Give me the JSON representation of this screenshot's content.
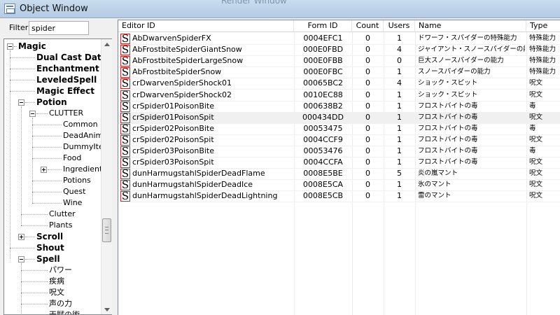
{
  "window": {
    "title": "Object Window",
    "background_title": "Render Window"
  },
  "filter": {
    "label": "Filter",
    "value": "spider"
  },
  "tree": {
    "items": [
      {
        "label": "Magic",
        "bold": true,
        "expander": "minus",
        "level": 0
      },
      {
        "label": "Dual Cast Data",
        "bold": true,
        "expander": "none",
        "level": 1
      },
      {
        "label": "Enchantment",
        "bold": true,
        "expander": "none",
        "level": 1
      },
      {
        "label": "LeveledSpell",
        "bold": true,
        "expander": "none",
        "level": 1
      },
      {
        "label": "Magic Effect",
        "bold": true,
        "expander": "none",
        "level": 1
      },
      {
        "label": "Potion",
        "bold": true,
        "expander": "minus",
        "level": 1
      },
      {
        "label": "CLUTTER",
        "bold": false,
        "expander": "minus",
        "level": 2
      },
      {
        "label": "Common",
        "bold": false,
        "expander": "none",
        "level": 3
      },
      {
        "label": "DeadAnima",
        "bold": false,
        "expander": "none",
        "level": 3
      },
      {
        "label": "DummyItem",
        "bold": false,
        "expander": "none",
        "level": 3
      },
      {
        "label": "Food",
        "bold": false,
        "expander": "none",
        "level": 3
      },
      {
        "label": "Ingredients",
        "bold": false,
        "expander": "plus",
        "level": 3
      },
      {
        "label": "Potions",
        "bold": false,
        "expander": "none",
        "level": 3
      },
      {
        "label": "Quest",
        "bold": false,
        "expander": "none",
        "level": 3
      },
      {
        "label": "Wine",
        "bold": false,
        "expander": "none",
        "level": 3
      },
      {
        "label": "Clutter",
        "bold": false,
        "expander": "none",
        "level": 2
      },
      {
        "label": "Plants",
        "bold": false,
        "expander": "none",
        "level": 2
      },
      {
        "label": "Scroll",
        "bold": true,
        "expander": "plus",
        "level": 1
      },
      {
        "label": "Shout",
        "bold": true,
        "expander": "none",
        "level": 1
      },
      {
        "label": "Spell",
        "bold": true,
        "expander": "minus",
        "level": 1
      },
      {
        "label": "パワー",
        "bold": false,
        "expander": "none",
        "level": 2
      },
      {
        "label": "疾病",
        "bold": false,
        "expander": "none",
        "level": 2
      },
      {
        "label": "呪文",
        "bold": false,
        "expander": "none",
        "level": 2
      },
      {
        "label": "声の力",
        "bold": false,
        "expander": "none",
        "level": 2
      },
      {
        "label": "天賦の術",
        "bold": false,
        "expander": "none",
        "level": 2
      }
    ]
  },
  "list": {
    "icon_glyph": "S",
    "columns": [
      "Editor ID",
      "Form ID",
      "Count",
      "Users",
      "Name",
      "Type"
    ],
    "selected_row": 8,
    "rows": [
      [
        "AbDwarvenSpiderFX",
        "0004EFC1",
        "0",
        "1",
        "ドワーフ・スパイダーの特殊能力",
        "特殊能力"
      ],
      [
        "AbFrostbiteSpiderGiantSnow",
        "000E0FBD",
        "0",
        "4",
        "ジャイアント・スノースパイダーの能力",
        "特殊能力"
      ],
      [
        "AbFrostbiteSpiderLargeSnow",
        "000E0FBB",
        "0",
        "0",
        "巨大スノースパイダーの能力",
        "特殊能力"
      ],
      [
        "AbFrostbiteSpiderSnow",
        "000E0FBC",
        "0",
        "1",
        "スノースパイダーの能力",
        "特殊能力"
      ],
      [
        "crDwarvenSpiderShock01",
        "00065BC2",
        "0",
        "4",
        "ショック・スピット",
        "呪文"
      ],
      [
        "crDwarvenSpiderShock02",
        "0010EC88",
        "0",
        "1",
        "ショック・スピット",
        "呪文"
      ],
      [
        "crSpider01PoisonBite",
        "000638B2",
        "0",
        "1",
        "フロストバイトの毒",
        "毒"
      ],
      [
        "crSpider01PoisonSpit",
        "000434DD",
        "0",
        "1",
        "フロストバイトの毒",
        "呪文"
      ],
      [
        "crSpider02PoisonBite",
        "00053475",
        "0",
        "1",
        "フロストバイトの毒",
        "毒"
      ],
      [
        "crSpider02PoisonSpit",
        "0004CCF9",
        "0",
        "1",
        "フロストバイトの毒",
        "呪文"
      ],
      [
        "crSpider03PoisonBite",
        "00053476",
        "0",
        "1",
        "フロストバイトの毒",
        "毒"
      ],
      [
        "crSpider03PoisonSpit",
        "0004CCFA",
        "0",
        "1",
        "フロストバイトの毒",
        "呪文"
      ],
      [
        "dunHarmugstahlSpiderDeadFlame",
        "0008E5BE",
        "0",
        "5",
        "炎の嵐マント",
        "呪文"
      ],
      [
        "dunHarmugstahlSpiderDeadIce",
        "0008E5CA",
        "0",
        "1",
        "氷のマント",
        "呪文"
      ],
      [
        "dunHarmugstahlSpiderDeadLightning",
        "0008E5CB",
        "0",
        "1",
        "雷のマント",
        "呪文"
      ]
    ]
  }
}
